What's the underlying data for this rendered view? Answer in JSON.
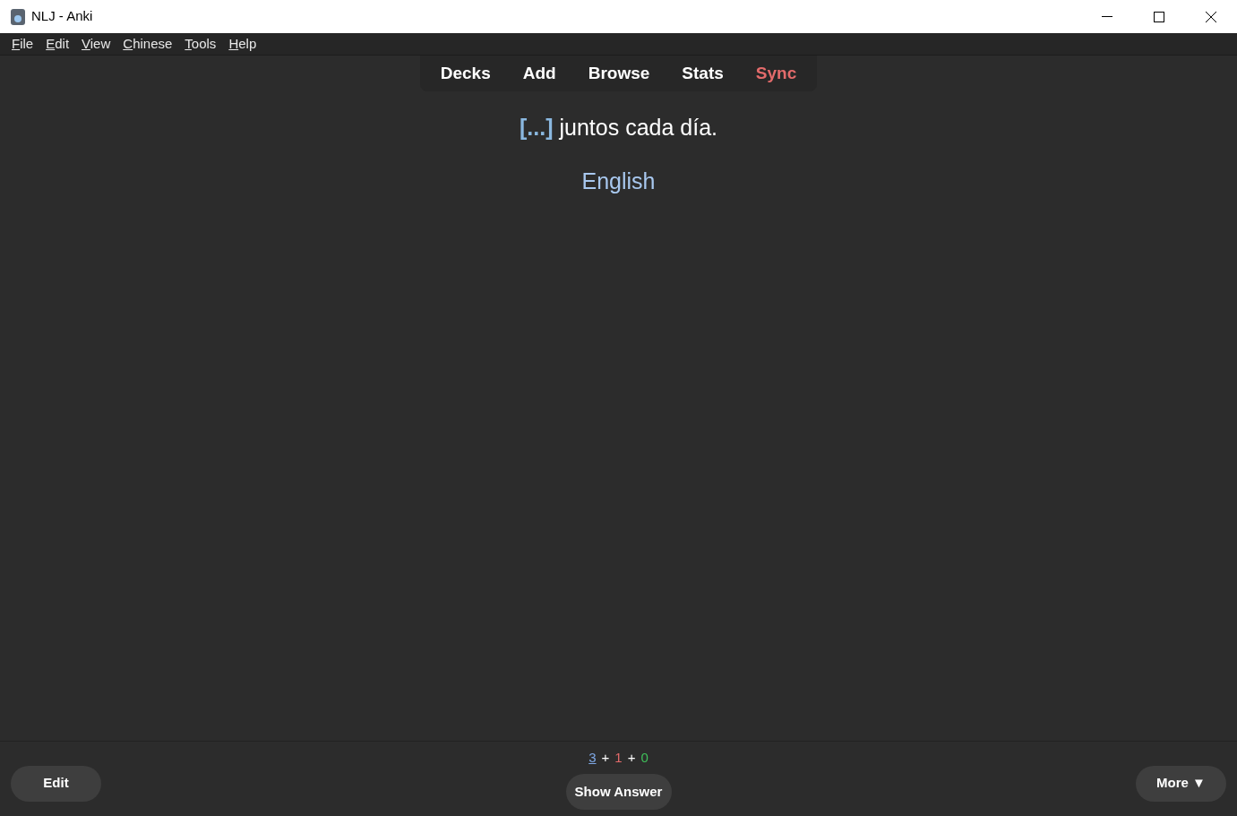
{
  "window": {
    "title": "NLJ - Anki"
  },
  "menu": [
    "File",
    "Edit",
    "View",
    "Chinese",
    "Tools",
    "Help"
  ],
  "toplinks": [
    {
      "label": "Decks",
      "color": "#ffffff"
    },
    {
      "label": "Add",
      "color": "#ffffff"
    },
    {
      "label": "Browse",
      "color": "#ffffff"
    },
    {
      "label": "Stats",
      "color": "#ffffff"
    },
    {
      "label": "Sync",
      "color": "#e36b6b"
    }
  ],
  "card": {
    "cloze": "[...]",
    "text": "juntos cada día.",
    "hint": "English"
  },
  "counts": [
    {
      "value": "3",
      "color": "#7ea8e6",
      "current": true
    },
    {
      "value": "1",
      "color": "#e36b6b",
      "current": false
    },
    {
      "value": "0",
      "color": "#3fbf5a",
      "current": false
    }
  ],
  "count_separator": "+",
  "bottom": {
    "left": "Edit",
    "center": "Show Answer",
    "right": "More ▼"
  }
}
